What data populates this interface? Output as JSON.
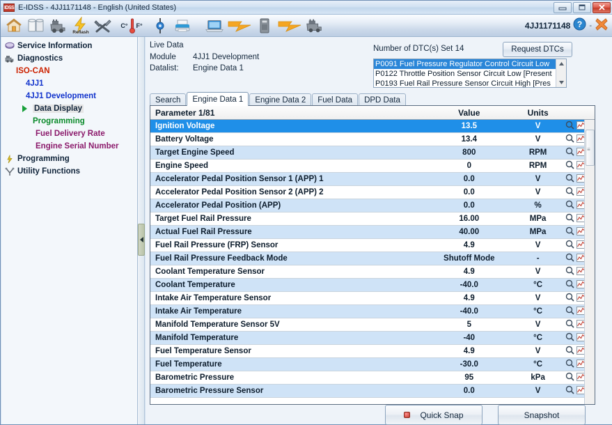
{
  "window": {
    "app_badge": "IDSS",
    "title": "E-IDSS - 4JJ1171148 - English (United States)",
    "minimize_label": "minimize",
    "maximize_label": "maximize",
    "close_label": "close"
  },
  "toolbar": {
    "icons": [
      {
        "name": "home-icon",
        "label": "Home"
      },
      {
        "name": "cylinders-icon",
        "label": "Vehicle Database"
      },
      {
        "name": "engine-icon",
        "label": "Engine"
      },
      {
        "name": "reflash-icon",
        "label": "Reflash"
      },
      {
        "name": "tools-icon",
        "label": "Tools"
      },
      {
        "name": "temperature-units-icon",
        "label": "C° F°"
      },
      {
        "name": "connector-icon",
        "label": "Connector"
      },
      {
        "name": "printer-icon",
        "label": "Print"
      },
      {
        "name": "laptop-icon",
        "label": "PC"
      },
      {
        "name": "lightning-left-icon",
        "label": "Link"
      },
      {
        "name": "interface-device-icon",
        "label": "Interface"
      },
      {
        "name": "lightning-right-icon",
        "label": "Link"
      },
      {
        "name": "engine-target-icon",
        "label": "Vehicle"
      }
    ],
    "reflash_text": "Reflash",
    "celsius_label": "C°",
    "fahrenheit_label": "F°",
    "serial": "4JJ1171148",
    "help_label": "?",
    "separator": "-",
    "close_label": "Close"
  },
  "sidebar": {
    "items": [
      {
        "label": "Service Information",
        "color": "black",
        "indent": 0,
        "icon": "book-icon",
        "selected": false
      },
      {
        "label": "Diagnostics",
        "color": "black",
        "indent": 0,
        "icon": "engine-small-icon",
        "selected": false
      },
      {
        "label": "ISO-CAN",
        "color": "red",
        "indent": 1,
        "icon": "",
        "selected": false
      },
      {
        "label": "4JJ1",
        "color": "blue",
        "indent": 2,
        "icon": "",
        "selected": false
      },
      {
        "label": "4JJ1 Development",
        "color": "blue",
        "indent": 2,
        "icon": "",
        "selected": false
      },
      {
        "label": "Data Display",
        "color": "black",
        "indent": 3,
        "icon": "arrow-green",
        "selected": true
      },
      {
        "label": "Programming",
        "color": "green",
        "indent": 3,
        "icon": "",
        "selected": false
      },
      {
        "label": "Fuel Delivery Rate",
        "color": "purple",
        "indent": 4,
        "icon": "",
        "selected": false
      },
      {
        "label": "Engine Serial Number",
        "color": "purple",
        "indent": 4,
        "icon": "",
        "selected": false
      },
      {
        "label": "Programming",
        "color": "black",
        "indent": 0,
        "icon": "programming-icon",
        "selected": false
      },
      {
        "label": "Utility Functions",
        "color": "black",
        "indent": 0,
        "icon": "utility-icon",
        "selected": false
      }
    ]
  },
  "splitter": {
    "collapse_label": "collapse panel"
  },
  "live_data": {
    "title": "Live Data",
    "module_key": "Module",
    "module_value": "4JJ1 Development",
    "datalist_key": "Datalist:",
    "datalist_value": "Engine Data 1"
  },
  "dtc": {
    "count_label": "Number of DTC(s) Set  14",
    "request_button": "Request DTCs",
    "items": [
      {
        "text": "P0091 Fuel Pressure Regulator Control Circuit Low",
        "selected": true
      },
      {
        "text": "P0122 Throttle Position Sensor Circuit Low [Present",
        "selected": false
      },
      {
        "text": "P0193 Fuel Rail Pressure Sensor Circuit High [Pres",
        "selected": false
      }
    ]
  },
  "tabs": [
    {
      "label": "Search",
      "active": false
    },
    {
      "label": "Engine Data 1",
      "active": true
    },
    {
      "label": "Engine Data 2",
      "active": false
    },
    {
      "label": "Fuel Data",
      "active": false
    },
    {
      "label": "DPD Data",
      "active": false
    }
  ],
  "table": {
    "headers": {
      "parameter": "Parameter 1/81",
      "value": "Value",
      "units": "Units"
    },
    "row_icons": {
      "magnify": "magnifier-icon",
      "graph": "graph-icon"
    },
    "rows": [
      {
        "parameter": "Ignition Voltage",
        "value": "13.5",
        "units": "V",
        "selected": true
      },
      {
        "parameter": "Battery Voltage",
        "value": "13.4",
        "units": "V",
        "selected": false
      },
      {
        "parameter": "Target Engine Speed",
        "value": "800",
        "units": "RPM",
        "selected": false
      },
      {
        "parameter": "Engine Speed",
        "value": "0",
        "units": "RPM",
        "selected": false
      },
      {
        "parameter": "Accelerator Pedal Position Sensor 1 (APP) 1",
        "value": "0.0",
        "units": "V",
        "selected": false
      },
      {
        "parameter": "Accelerator Pedal Position Sensor 2 (APP) 2",
        "value": "0.0",
        "units": "V",
        "selected": false
      },
      {
        "parameter": "Accelerator Pedal Position (APP)",
        "value": "0.0",
        "units": "%",
        "selected": false
      },
      {
        "parameter": "Target Fuel Rail Pressure",
        "value": "16.00",
        "units": "MPa",
        "selected": false
      },
      {
        "parameter": "Actual Fuel Rail Pressure",
        "value": "40.00",
        "units": "MPa",
        "selected": false
      },
      {
        "parameter": "Fuel Rail Pressure (FRP) Sensor",
        "value": "4.9",
        "units": "V",
        "selected": false
      },
      {
        "parameter": "Fuel Rail Pressure Feedback Mode",
        "value": "Shutoff Mode",
        "units": "-",
        "selected": false
      },
      {
        "parameter": "Coolant Temperature Sensor",
        "value": "4.9",
        "units": "V",
        "selected": false
      },
      {
        "parameter": "Coolant Temperature",
        "value": "-40.0",
        "units": "°C",
        "selected": false
      },
      {
        "parameter": "Intake Air Temperature Sensor",
        "value": "4.9",
        "units": "V",
        "selected": false
      },
      {
        "parameter": "Intake Air Temperature",
        "value": "-40.0",
        "units": "°C",
        "selected": false
      },
      {
        "parameter": "Manifold Temperature Sensor 5V",
        "value": "5",
        "units": "V",
        "selected": false
      },
      {
        "parameter": "Manifold Temperature",
        "value": "-40",
        "units": "°C",
        "selected": false
      },
      {
        "parameter": "Fuel Temperature Sensor",
        "value": "4.9",
        "units": "V",
        "selected": false
      },
      {
        "parameter": "Fuel Temperature",
        "value": "-30.0",
        "units": "°C",
        "selected": false
      },
      {
        "parameter": "Barometric Pressure",
        "value": "95",
        "units": "kPa",
        "selected": false
      },
      {
        "parameter": "Barometric Pressure Sensor",
        "value": "0.0",
        "units": "V",
        "selected": false
      }
    ]
  },
  "buttons": {
    "quick_snap": "Quick Snap",
    "snapshot": "Snapshot"
  },
  "colors": {
    "selection_blue": "#1f8fe8",
    "alt_row_blue": "#cfe3f7",
    "tree_red": "#cc2200",
    "tree_blue": "#1133cc",
    "tree_green": "#0a8a2a",
    "tree_purple": "#8b1a6b"
  }
}
